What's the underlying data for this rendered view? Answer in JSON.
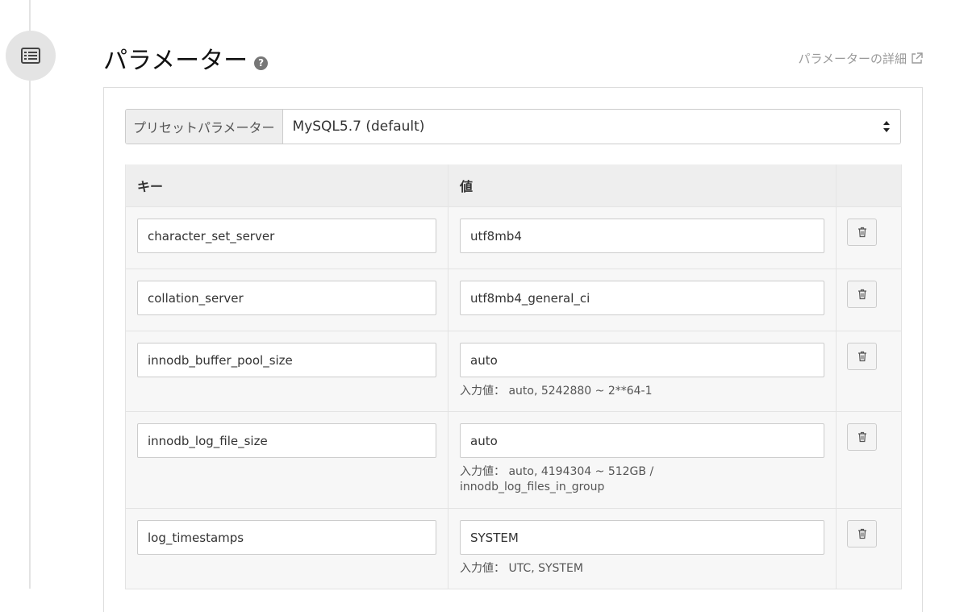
{
  "section": {
    "title": "パラメーター",
    "help_icon": "question-circle-icon",
    "detail_link": "パラメーターの詳細"
  },
  "preset": {
    "label": "プリセットパラメーター",
    "value": "MySQL5.7 (default)"
  },
  "table": {
    "headers": {
      "key": "キー",
      "value": "値"
    },
    "rows": [
      {
        "key": "character_set_server",
        "value": "utf8mb4",
        "hint": ""
      },
      {
        "key": "collation_server",
        "value": "utf8mb4_general_ci",
        "hint": ""
      },
      {
        "key": "innodb_buffer_pool_size",
        "value": "auto",
        "hint": "入力値： auto, 5242880 ~ 2**64-1"
      },
      {
        "key": "innodb_log_file_size",
        "value": "auto",
        "hint": "入力値： auto, 4194304 ~ 512GB / innodb_log_files_in_group"
      },
      {
        "key": "log_timestamps",
        "value": "SYSTEM",
        "hint": "入力値： UTC, SYSTEM"
      }
    ]
  },
  "colors": {
    "panel_border": "#dddddd",
    "header_bg": "#eeeeee",
    "row_bg": "#f7f7f7",
    "link": "#9a9a9a"
  }
}
